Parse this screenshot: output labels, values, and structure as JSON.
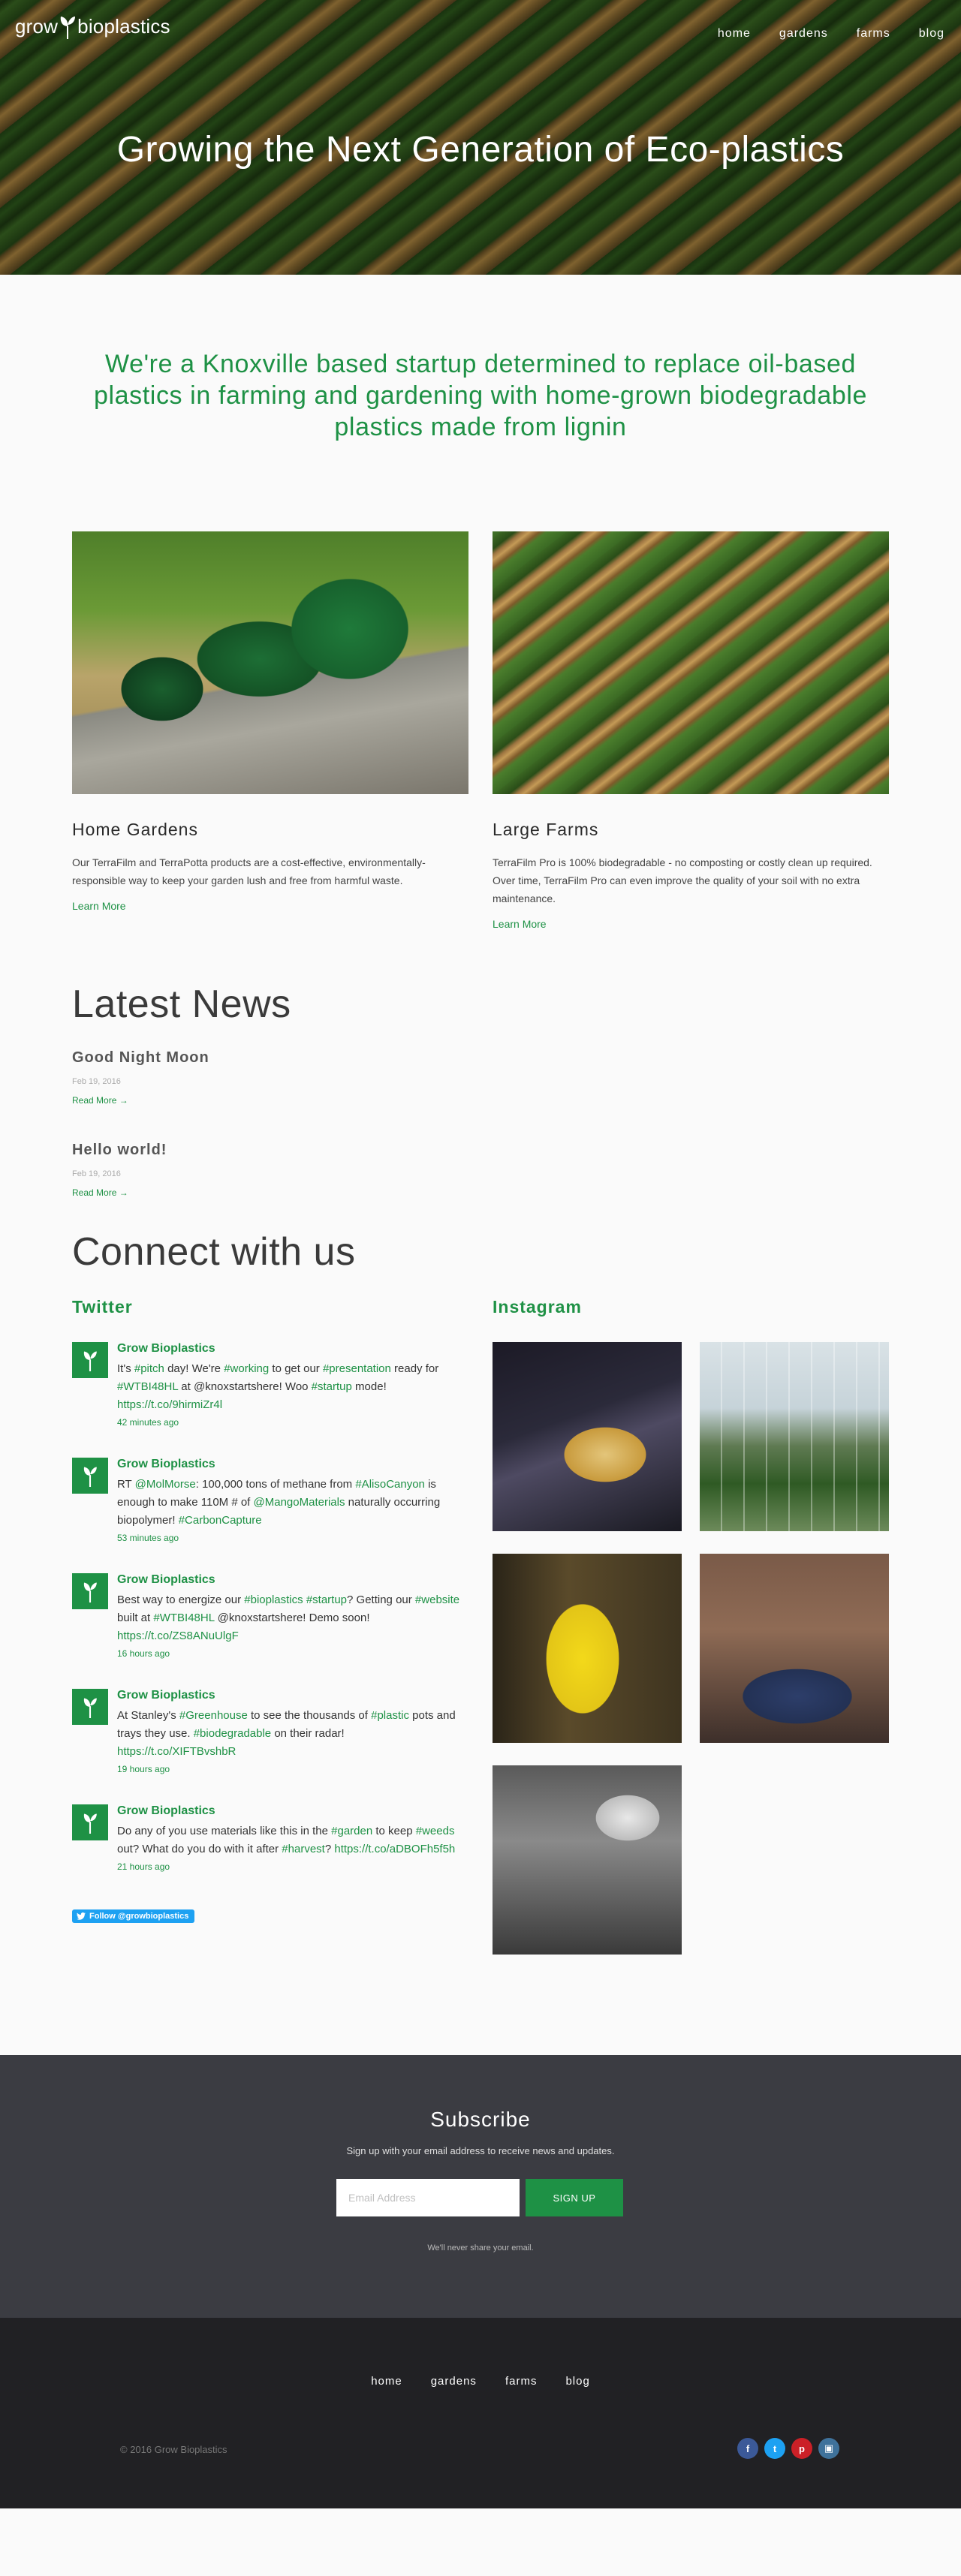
{
  "brand": {
    "logo_text_left": "grow",
    "logo_text_right": "bioplastics",
    "accent_color": "#1e9145"
  },
  "nav": {
    "items": [
      {
        "label": "home"
      },
      {
        "label": "gardens"
      },
      {
        "label": "farms"
      },
      {
        "label": "blog"
      }
    ]
  },
  "hero": {
    "title": "Growing the Next Generation of Eco-plastics"
  },
  "intro": {
    "text": "We're a Knoxville based startup determined to replace oil-based plastics in farming and gardening with home-grown biodegradable plastics made from lignin"
  },
  "products": [
    {
      "title": "Home Gardens",
      "description": "Our TerraFilm and TerraPotta products are a cost-effective, environmentally-responsible way to keep your garden lush and free from harmful waste.",
      "link": "Learn More"
    },
    {
      "title": "Large Farms",
      "description": "TerraFilm Pro is 100% biodegradable - no composting or costly clean up required. Over time, TerraFilm Pro can even improve the quality of your soil with no extra maintenance.",
      "link": "Learn More"
    }
  ],
  "news": {
    "title": "Latest News",
    "items": [
      {
        "title": "Good Night Moon",
        "date": "Feb 19, 2016",
        "link": "Read More →"
      },
      {
        "title": "Hello world!",
        "date": "Feb 19, 2016",
        "link": "Read More →"
      }
    ]
  },
  "connect": {
    "title": "Connect with us",
    "twitter_title": "Twitter",
    "instagram_title": "Instagram",
    "follow_label": "Follow @growbioplastics",
    "tweets": [
      {
        "name": "Grow Bioplastics",
        "parts": [
          [
            "It's ",
            false
          ],
          [
            "#pitch",
            true
          ],
          [
            " day! We're ",
            false
          ],
          [
            "#working",
            true
          ],
          [
            " to get our ",
            false
          ],
          [
            "#presentation",
            true
          ],
          [
            " ready for ",
            false
          ],
          [
            "#WTBI48HL",
            true
          ],
          [
            " at @knoxstartshere! Woo ",
            false
          ],
          [
            "#startup",
            true
          ],
          [
            " mode! ",
            false
          ],
          [
            "https://t.co/9hirmiZr4l",
            true
          ]
        ],
        "time": "42 minutes ago"
      },
      {
        "name": "Grow Bioplastics",
        "parts": [
          [
            "RT ",
            false
          ],
          [
            "@MolMorse",
            true
          ],
          [
            ": 100,000 tons of methane from ",
            false
          ],
          [
            "#AlisoCanyon",
            true
          ],
          [
            " is enough to make 110M # of ",
            false
          ],
          [
            "@MangoMaterials",
            true
          ],
          [
            " naturally occurring biopolymer! ",
            false
          ],
          [
            "#CarbonCapture",
            true
          ]
        ],
        "time": "53 minutes ago"
      },
      {
        "name": "Grow Bioplastics",
        "parts": [
          [
            "Best way to energize our ",
            false
          ],
          [
            "#bioplastics",
            true
          ],
          [
            " ",
            false
          ],
          [
            "#startup",
            true
          ],
          [
            "? Getting our ",
            false
          ],
          [
            "#website",
            true
          ],
          [
            " built at ",
            false
          ],
          [
            "#WTBI48HL",
            true
          ],
          [
            " @knoxstartshere! Demo soon! ",
            false
          ],
          [
            "https://t.co/ZS8ANuUlgF",
            true
          ]
        ],
        "time": "16 hours ago"
      },
      {
        "name": "Grow Bioplastics",
        "parts": [
          [
            "At Stanley's ",
            false
          ],
          [
            "#Greenhouse",
            true
          ],
          [
            " to see the thousands of ",
            false
          ],
          [
            "#plastic",
            true
          ],
          [
            " pots and trays they use. ",
            false
          ],
          [
            "#biodegradable",
            true
          ],
          [
            " on their radar! ",
            false
          ],
          [
            "https://t.co/XIFTBvshbR",
            true
          ]
        ],
        "time": "19 hours ago"
      },
      {
        "name": "Grow Bioplastics",
        "parts": [
          [
            "Do any of you use materials like this in the ",
            false
          ],
          [
            "#garden",
            true
          ],
          [
            " to keep ",
            false
          ],
          [
            "#weeds",
            true
          ],
          [
            " out? What do you do with it after ",
            false
          ],
          [
            "#harvest",
            true
          ],
          [
            "? ",
            false
          ],
          [
            "https://t.co/aDBOFh5f5h",
            true
          ]
        ],
        "time": "21 hours ago"
      }
    ]
  },
  "subscribe": {
    "title": "Subscribe",
    "text": "Sign up with your email address to receive news and updates.",
    "placeholder": "Email Address",
    "button": "SIGN UP",
    "note": "We'll never share your email."
  },
  "footer": {
    "links": [
      {
        "label": "home"
      },
      {
        "label": "gardens"
      },
      {
        "label": "farms"
      },
      {
        "label": "blog"
      }
    ],
    "copyright": "© 2016 Grow Bioplastics",
    "social": [
      {
        "icon": "facebook-icon",
        "glyph": "f",
        "color": "#3b5998"
      },
      {
        "icon": "twitter-icon",
        "glyph": "t",
        "color": "#1da1f2"
      },
      {
        "icon": "pinterest-icon",
        "glyph": "p",
        "color": "#cb2027"
      },
      {
        "icon": "instagram-icon",
        "glyph": "▣",
        "color": "#3f729b"
      }
    ]
  }
}
